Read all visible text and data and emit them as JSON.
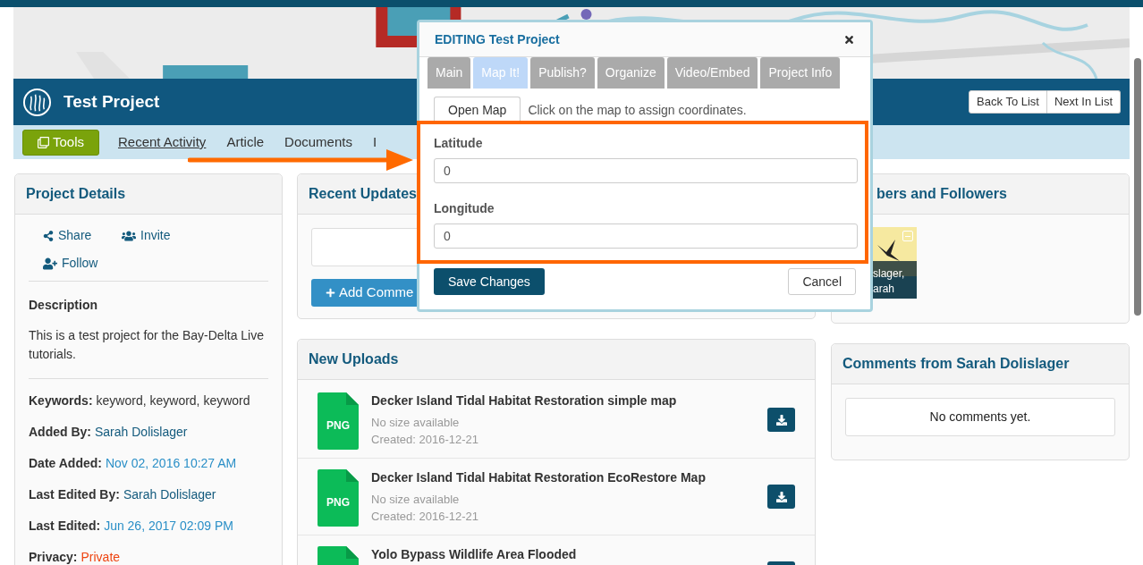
{
  "project": {
    "title": "Test Project"
  },
  "list_nav": [
    "Back To List",
    "Next In List"
  ],
  "nav": [
    {
      "label": "Tools",
      "kind": "tool",
      "selected": false
    },
    {
      "label": "Recent Activity",
      "kind": "link",
      "selected": true
    },
    {
      "label": "Article",
      "kind": "link",
      "selected": false
    },
    {
      "label": "Documents",
      "kind": "link",
      "selected": false
    },
    {
      "label": "I",
      "kind": "link",
      "selected": false
    }
  ],
  "details": {
    "title": "Project Details",
    "actions": [
      {
        "label": "Share",
        "kind": "share"
      },
      {
        "label": "Invite",
        "kind": "invite"
      },
      {
        "label": "Follow",
        "kind": "follow"
      }
    ],
    "description_heading": "Description",
    "description": "This is a test project for the Bay-Delta Live tutorials.",
    "fields": [
      {
        "label": "Keywords:",
        "value": "keyword, keyword, keyword",
        "kind": "plain"
      },
      {
        "label": "Added By:",
        "value": "Sarah Dolislager",
        "kind": "person"
      },
      {
        "label": "Date Added:",
        "value": "Nov 02, 2016 10:27 AM",
        "kind": "date"
      },
      {
        "label": "Last Edited By:",
        "value": "Sarah Dolislager",
        "kind": "person"
      },
      {
        "label": "Last Edited:",
        "value": "Jun 26, 2017 02:09 PM",
        "kind": "date"
      },
      {
        "label": "Privacy:",
        "value": "Private",
        "kind": "alert"
      }
    ]
  },
  "recent_updates": {
    "title": "Recent Updates",
    "button": "Add Comme"
  },
  "uploads": {
    "title": "New Uploads",
    "files": [
      {
        "type": "PNG",
        "name": "Decker Island Tidal Habitat Restoration simple map",
        "size": "No size available",
        "created": "Created: 2016-12-21"
      },
      {
        "type": "PNG",
        "name": "Decker Island Tidal Habitat Restoration EcoRestore Map",
        "size": "No size available",
        "created": "Created: 2016-12-21"
      },
      {
        "name": "Yolo Bypass Wildlife Area Flooded"
      }
    ]
  },
  "members": {
    "title": "bers and Followers",
    "cards": [
      {
        "caption": "slager, arah"
      }
    ]
  },
  "comments": {
    "title": "Comments from Sarah Dolislager",
    "empty": "No comments yet."
  },
  "modal": {
    "title": "EDITING Test Project",
    "tabs": [
      {
        "label": "Main",
        "selected": false
      },
      {
        "label": "Map It!",
        "selected": true
      },
      {
        "label": "Publish?",
        "selected": false
      },
      {
        "label": "Organize",
        "selected": false
      },
      {
        "label": "Video/Embed",
        "selected": false
      },
      {
        "label": "Project Info",
        "selected": false
      }
    ],
    "open_map": "Open Map",
    "hint": "Click on the map to assign coordinates.",
    "fields": [
      {
        "label": "Latitude",
        "value": "0"
      },
      {
        "label": "Longitude",
        "value": "0"
      }
    ],
    "save": "Save Changes",
    "cancel": "Cancel"
  }
}
